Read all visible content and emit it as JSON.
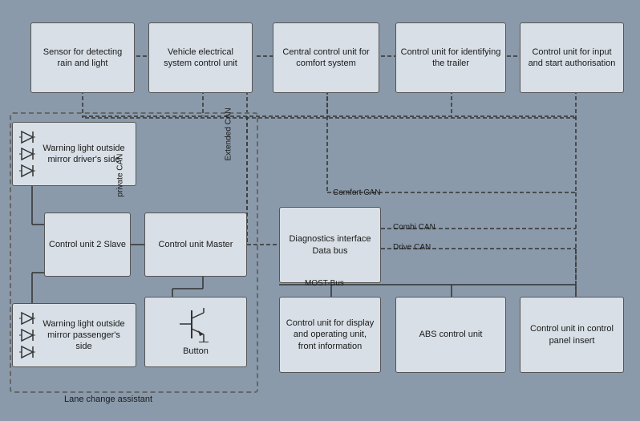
{
  "boxes": {
    "sensor": {
      "label": "Sensor for detecting rain and light"
    },
    "vehicle_elec": {
      "label": "Vehicle electrical system control unit"
    },
    "central_control": {
      "label": "Central control unit for comfort system"
    },
    "trailer": {
      "label": "Control unit for identifying the trailer"
    },
    "start_auth": {
      "label": "Control unit for input and start authorisation"
    },
    "warning_driver": {
      "label": "Warning light outside mirror driver's side"
    },
    "control_slave": {
      "label": "Control unit 2 Slave"
    },
    "control_master": {
      "label": "Control unit Master"
    },
    "diagnostics": {
      "label": "Diagnostics interface Data bus"
    },
    "warning_passenger": {
      "label": "Warning light outside mirror passenger's side"
    },
    "button": {
      "label": "Button"
    },
    "display_unit": {
      "label": "Control unit for display and operating unit, front information"
    },
    "abs": {
      "label": "ABS control unit"
    },
    "control_panel": {
      "label": "Control unit in control panel insert"
    }
  },
  "labels": {
    "private_can": "private CAN",
    "extended_can": "Extended CAN",
    "comfort_can": "Comfort CAN",
    "combi_can": "Combi CAN",
    "drive_can": "Drive CAN",
    "most_bus": "MOST-Bus",
    "lane_change": "Lane change assistant"
  }
}
